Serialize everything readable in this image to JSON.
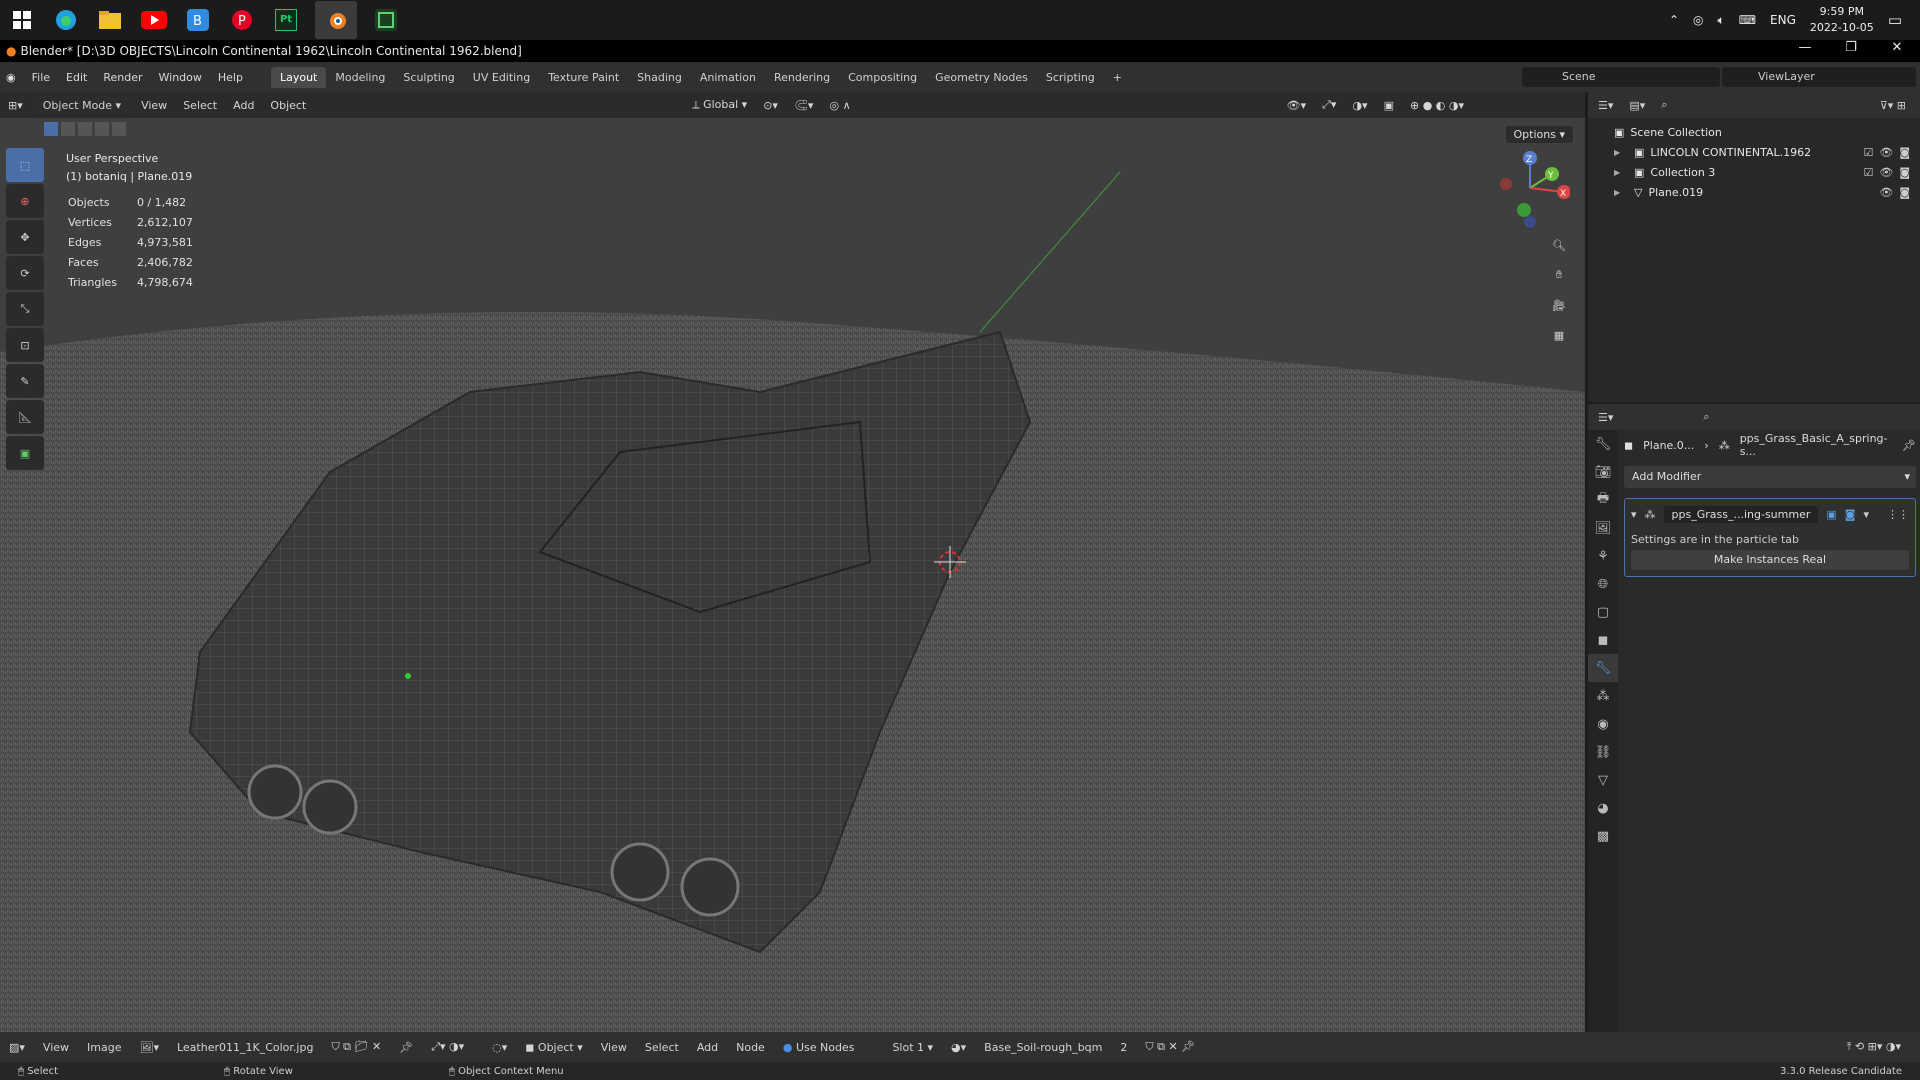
{
  "taskbar": {
    "icons": [
      "windows-start-icon",
      "edge-icon",
      "file-explorer-icon",
      "youtube-icon",
      "bluestacks-icon",
      "pinterest-icon",
      "pt-icon",
      "blender-icon",
      "app-icon"
    ],
    "pt_label": "Pt",
    "lang": "ENG",
    "time": "9:59 PM",
    "date": "2022-10-05"
  },
  "window": {
    "title": "Blender* [D:\\3D OBJECTS\\Lincoln Continental 1962\\Lincoln Continental 1962.blend]"
  },
  "menubar": {
    "menus": [
      "File",
      "Edit",
      "Render",
      "Window",
      "Help"
    ],
    "workspaces": [
      "Layout",
      "Modeling",
      "Sculpting",
      "UV Editing",
      "Texture Paint",
      "Shading",
      "Animation",
      "Rendering",
      "Compositing",
      "Geometry Nodes",
      "Scripting"
    ],
    "active_workspace": "Layout",
    "scene": "Scene",
    "view_layer": "ViewLayer"
  },
  "viewport": {
    "mode": "Object Mode",
    "menus": [
      "View",
      "Select",
      "Add",
      "Object"
    ],
    "orientation": "Global",
    "options": "Options",
    "overlay_title": "User Perspective",
    "overlay_sub": "(1) botaniq | Plane.019",
    "stats": [
      {
        "label": "Objects",
        "value": "0 / 1,482"
      },
      {
        "label": "Vertices",
        "value": "2,612,107"
      },
      {
        "label": "Edges",
        "value": "4,973,581"
      },
      {
        "label": "Faces",
        "value": "2,406,782"
      },
      {
        "label": "Triangles",
        "value": "4,798,674"
      }
    ],
    "gizmo": {
      "x": "X",
      "y": "Y",
      "z": "Z"
    }
  },
  "outliner": {
    "root": "Scene Collection",
    "items": [
      "LINCOLN CONTINENTAL.1962",
      "Collection 3",
      "Plane.019"
    ]
  },
  "properties": {
    "breadcrumb_object": "Plane.0...",
    "breadcrumb_modifier": "pps_Grass_Basic_A_spring-s...",
    "add_modifier": "Add Modifier",
    "modifier_name": "pps_Grass_...ing-summer",
    "note": "Settings are in the particle tab",
    "make_real": "Make Instances Real"
  },
  "bottombar": {
    "left_menus": [
      "View",
      "Image"
    ],
    "image_name": "Leather011_1K_Color.jpg",
    "object_label": "Object",
    "node_menus": [
      "View",
      "Select",
      "Add",
      "Node"
    ],
    "use_nodes": "Use Nodes",
    "slot": "Slot 1",
    "material": "Base_Soil-rough_bqm",
    "users": "2"
  },
  "statusbar": {
    "select": "Select",
    "rotate": "Rotate View",
    "context": "Object Context Menu",
    "version": "3.3.0 Release Candidate"
  }
}
